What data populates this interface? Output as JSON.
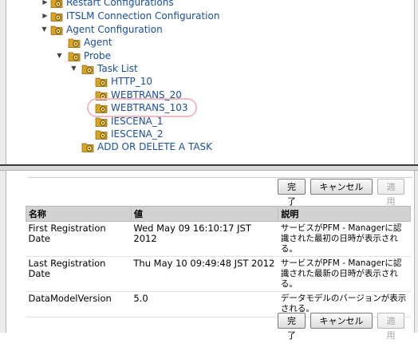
{
  "tree": {
    "items": [
      {
        "label": "Restart Configurations"
      },
      {
        "label": "ITSLM Connection Configuration"
      },
      {
        "label": "Agent Configuration"
      },
      {
        "label": "Agent"
      },
      {
        "label": "Probe"
      },
      {
        "label": "Task List"
      },
      {
        "label": "HTTP_10"
      },
      {
        "label": "WEBTRANS_20"
      },
      {
        "label": "WEBTRANS_103"
      },
      {
        "label": "IESCENA_1"
      },
      {
        "label": "IESCENA_2"
      },
      {
        "label": "ADD OR DELETE A TASK"
      }
    ],
    "selected": "WEBTRANS_103"
  },
  "buttons": {
    "finish": "完了",
    "cancel": "キャンセル",
    "apply": "適用"
  },
  "table": {
    "headers": [
      "名称",
      "値",
      "説明"
    ],
    "rows": [
      {
        "name": "First Registration Date",
        "value": "Wed May 09 16:10:17 JST 2012",
        "description": "サービスがPFM - Managerに認識された最初の日時が表示される。"
      },
      {
        "name": "Last Registration Date",
        "value": "Thu May 10 09:49:48 JST 2012",
        "description": "サービスがPFM - Managerに認識された最新の日時が表示される。"
      },
      {
        "name": "DataModelVersion",
        "value": "5.0",
        "description": "データモデルのバージョンが表示される。"
      }
    ]
  },
  "colors": {
    "link": "#1a4fa0",
    "highlight_outline": "#f1b9c2",
    "folder_icon": "#d9a420"
  }
}
